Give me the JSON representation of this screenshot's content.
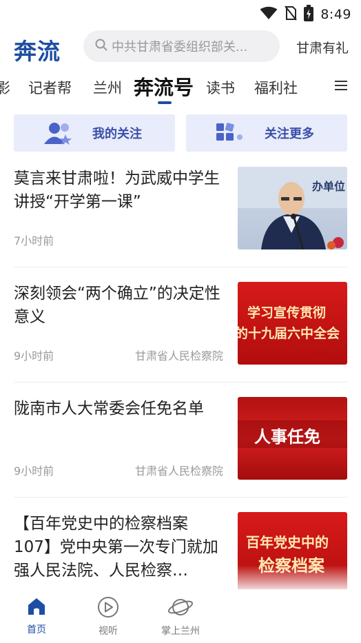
{
  "status_bar": {
    "time": "8:49",
    "icons": [
      "wifi-icon",
      "no-sim-icon",
      "battery-charging-icon"
    ]
  },
  "header": {
    "logo": "奔流",
    "search_placeholder": "中共甘肃省委组织部关...",
    "right_link": "甘肃有礼"
  },
  "channels": {
    "items": [
      {
        "label": "影"
      },
      {
        "label": "记者帮"
      },
      {
        "label": "兰州"
      },
      {
        "label": "奔流号",
        "active": true
      },
      {
        "label": "读书"
      },
      {
        "label": "福利社"
      }
    ]
  },
  "quick_actions": {
    "my_follow": "我的关注",
    "follow_more": "关注更多"
  },
  "news": [
    {
      "title": "莫言来甘肃啦！为武威中学生讲授“开学第一课”",
      "time": "7小时前",
      "source": "",
      "thumb": {
        "text": "办单位"
      }
    },
    {
      "title": "深刻领会“两个确立”的决定性意义",
      "time": "9小时前",
      "source": "甘肃省人民检察院",
      "thumb": {
        "line1": "学习宣传贯彻",
        "line2": "的十九届六中全会"
      }
    },
    {
      "title": "陇南市人大常委会任免名单",
      "time": "9小时前",
      "source": "甘肃省人民检察院",
      "thumb": {
        "text": "人事任免"
      }
    },
    {
      "title": "【百年党史中的检察档案107】党中央第一次专门就加强人民法院、人民检察…",
      "time": "",
      "source": "",
      "thumb": {
        "line1": "百年党史中的",
        "line2": "检察档案"
      }
    }
  ],
  "bottom_nav": {
    "items": [
      {
        "label": "首页",
        "active": true,
        "icon": "home-icon"
      },
      {
        "label": "视听",
        "icon": "play-circle-icon"
      },
      {
        "label": "掌上兰州",
        "icon": "planet-icon"
      }
    ]
  },
  "colors": {
    "brand": "#1d4ea3",
    "quick_bg": "#e9ecfa",
    "thumb_red": "#c81414"
  }
}
